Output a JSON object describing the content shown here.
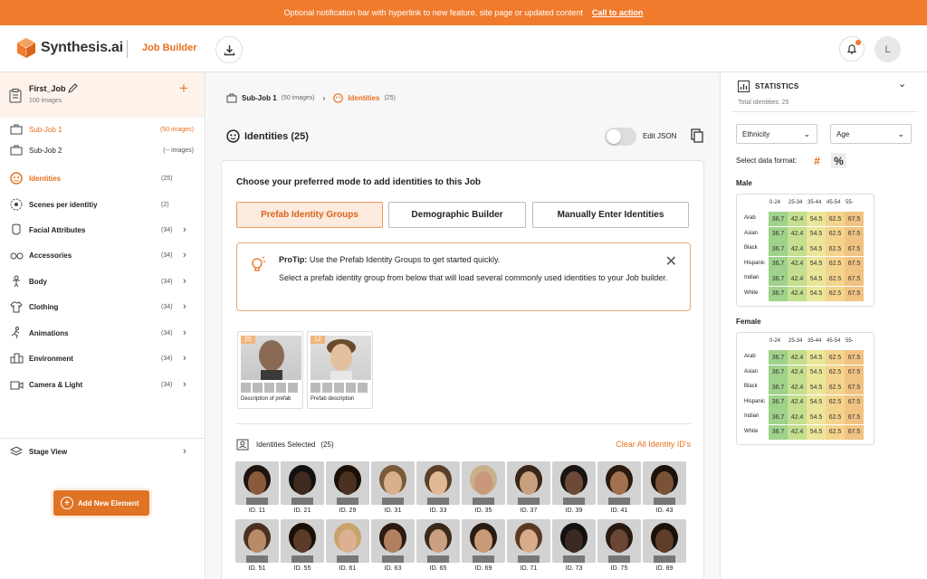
{
  "banner": {
    "text": "Optional notification bar with hyperlink to new feature, site page or updated content",
    "cta": "Call to action"
  },
  "header": {
    "brand": "Synthesis.ai",
    "product": "Job Builder",
    "avatar_letter": "L"
  },
  "sidebar": {
    "job": {
      "name": "First_Job",
      "count": "100 images"
    },
    "items": [
      {
        "label": "Sub-Job 1",
        "count": "(50 images)"
      },
      {
        "label": "Sub-Job 2",
        "count": "(-- images)"
      },
      {
        "label": "Identities",
        "count": "(25)"
      },
      {
        "label": "Scenes per identitiy",
        "count": "(2)"
      },
      {
        "label": "Facial Attributes",
        "count": "(34)"
      },
      {
        "label": "Accessories",
        "count": "(34)"
      },
      {
        "label": "Body",
        "count": "(34)"
      },
      {
        "label": "Clothing",
        "count": "(34)"
      },
      {
        "label": "Animations",
        "count": "(34)"
      },
      {
        "label": "Environment",
        "count": "(34)"
      },
      {
        "label": "Camera & Light",
        "count": "(34)"
      }
    ],
    "stage_view": "Stage View",
    "add_element": "Add New Element"
  },
  "main": {
    "breadcrumb": {
      "subjob": "Sub-Job 1",
      "subjob_count": "(50 images)",
      "current": "Identities",
      "current_count": "(25)"
    },
    "title": "Identities (25)",
    "edit_json": "Edit JSON",
    "card": {
      "heading": "Choose your preferred mode to add identities to this Job",
      "modes": [
        "Prefab Identity Groups",
        "Demographic Builder",
        "Manually Enter Identities"
      ],
      "protip_label": "ProTip:",
      "protip_line1": "Use the Prefab Identity Groups to get started quickly.",
      "protip_line2": "Select a prefab identity group from below that will load several commonly used identities to your Job builder.",
      "prefabs": [
        {
          "badge": "25",
          "desc": "Description of prefab"
        },
        {
          "badge": "12",
          "desc": "Prefab description"
        }
      ],
      "selected_label": "Identities Selected",
      "selected_count": "(25)",
      "clear_all": "Clear All Identity ID's",
      "ids": [
        "ID. 11",
        "ID. 21",
        "ID. 29",
        "ID. 31",
        "ID. 33",
        "ID. 35",
        "ID. 37",
        "ID. 39",
        "ID. 41",
        "ID. 43",
        "ID. 51",
        "ID. 55",
        "ID. 61",
        "ID. 63",
        "ID. 65",
        "ID. 69",
        "ID. 71",
        "ID. 73",
        "ID. 75",
        "ID. 89"
      ]
    }
  },
  "stats": {
    "title": "STATISTICS",
    "total": "Total Identities: 25",
    "dropdown1": "Ethnicity",
    "dropdown2": "Age",
    "format_label": "Select data format:",
    "format_hash": "#",
    "format_pct": "%",
    "age_groups": [
      "0-24",
      "25-34",
      "35-44",
      "45-54",
      "55-"
    ],
    "ethnicities": [
      "Arab",
      "Asian",
      "Black",
      "Hispanic",
      "Indian",
      "White"
    ],
    "male_title": "Male",
    "female_title": "Female",
    "male_values": [
      [
        36.7,
        42.4,
        54.5,
        62.5,
        67.5
      ],
      [
        36.7,
        42.4,
        54.5,
        62.5,
        67.5
      ],
      [
        36.7,
        42.4,
        54.5,
        62.5,
        67.5
      ],
      [
        36.7,
        42.4,
        54.5,
        62.5,
        67.5
      ],
      [
        36.7,
        42.4,
        54.5,
        62.5,
        67.5
      ],
      [
        36.7,
        42.4,
        54.5,
        62.5,
        67.5
      ]
    ],
    "female_values": [
      [
        36.7,
        42.4,
        54.5,
        62.5,
        67.5
      ],
      [
        36.7,
        42.4,
        54.5,
        62.5,
        67.5
      ],
      [
        36.7,
        42.4,
        54.5,
        62.5,
        67.5
      ],
      [
        36.7,
        42.4,
        54.5,
        62.5,
        67.5
      ],
      [
        36.7,
        42.4,
        54.5,
        62.5,
        67.5
      ],
      [
        36.7,
        42.4,
        54.5,
        62.5,
        67.5
      ]
    ],
    "cell_colors": [
      "#9fd28a",
      "#c3df8f",
      "#e9e69a",
      "#f4d48c",
      "#f1c382"
    ]
  },
  "colors": {
    "accent": "#f07b2d",
    "accent_dark": "#e8701e"
  }
}
